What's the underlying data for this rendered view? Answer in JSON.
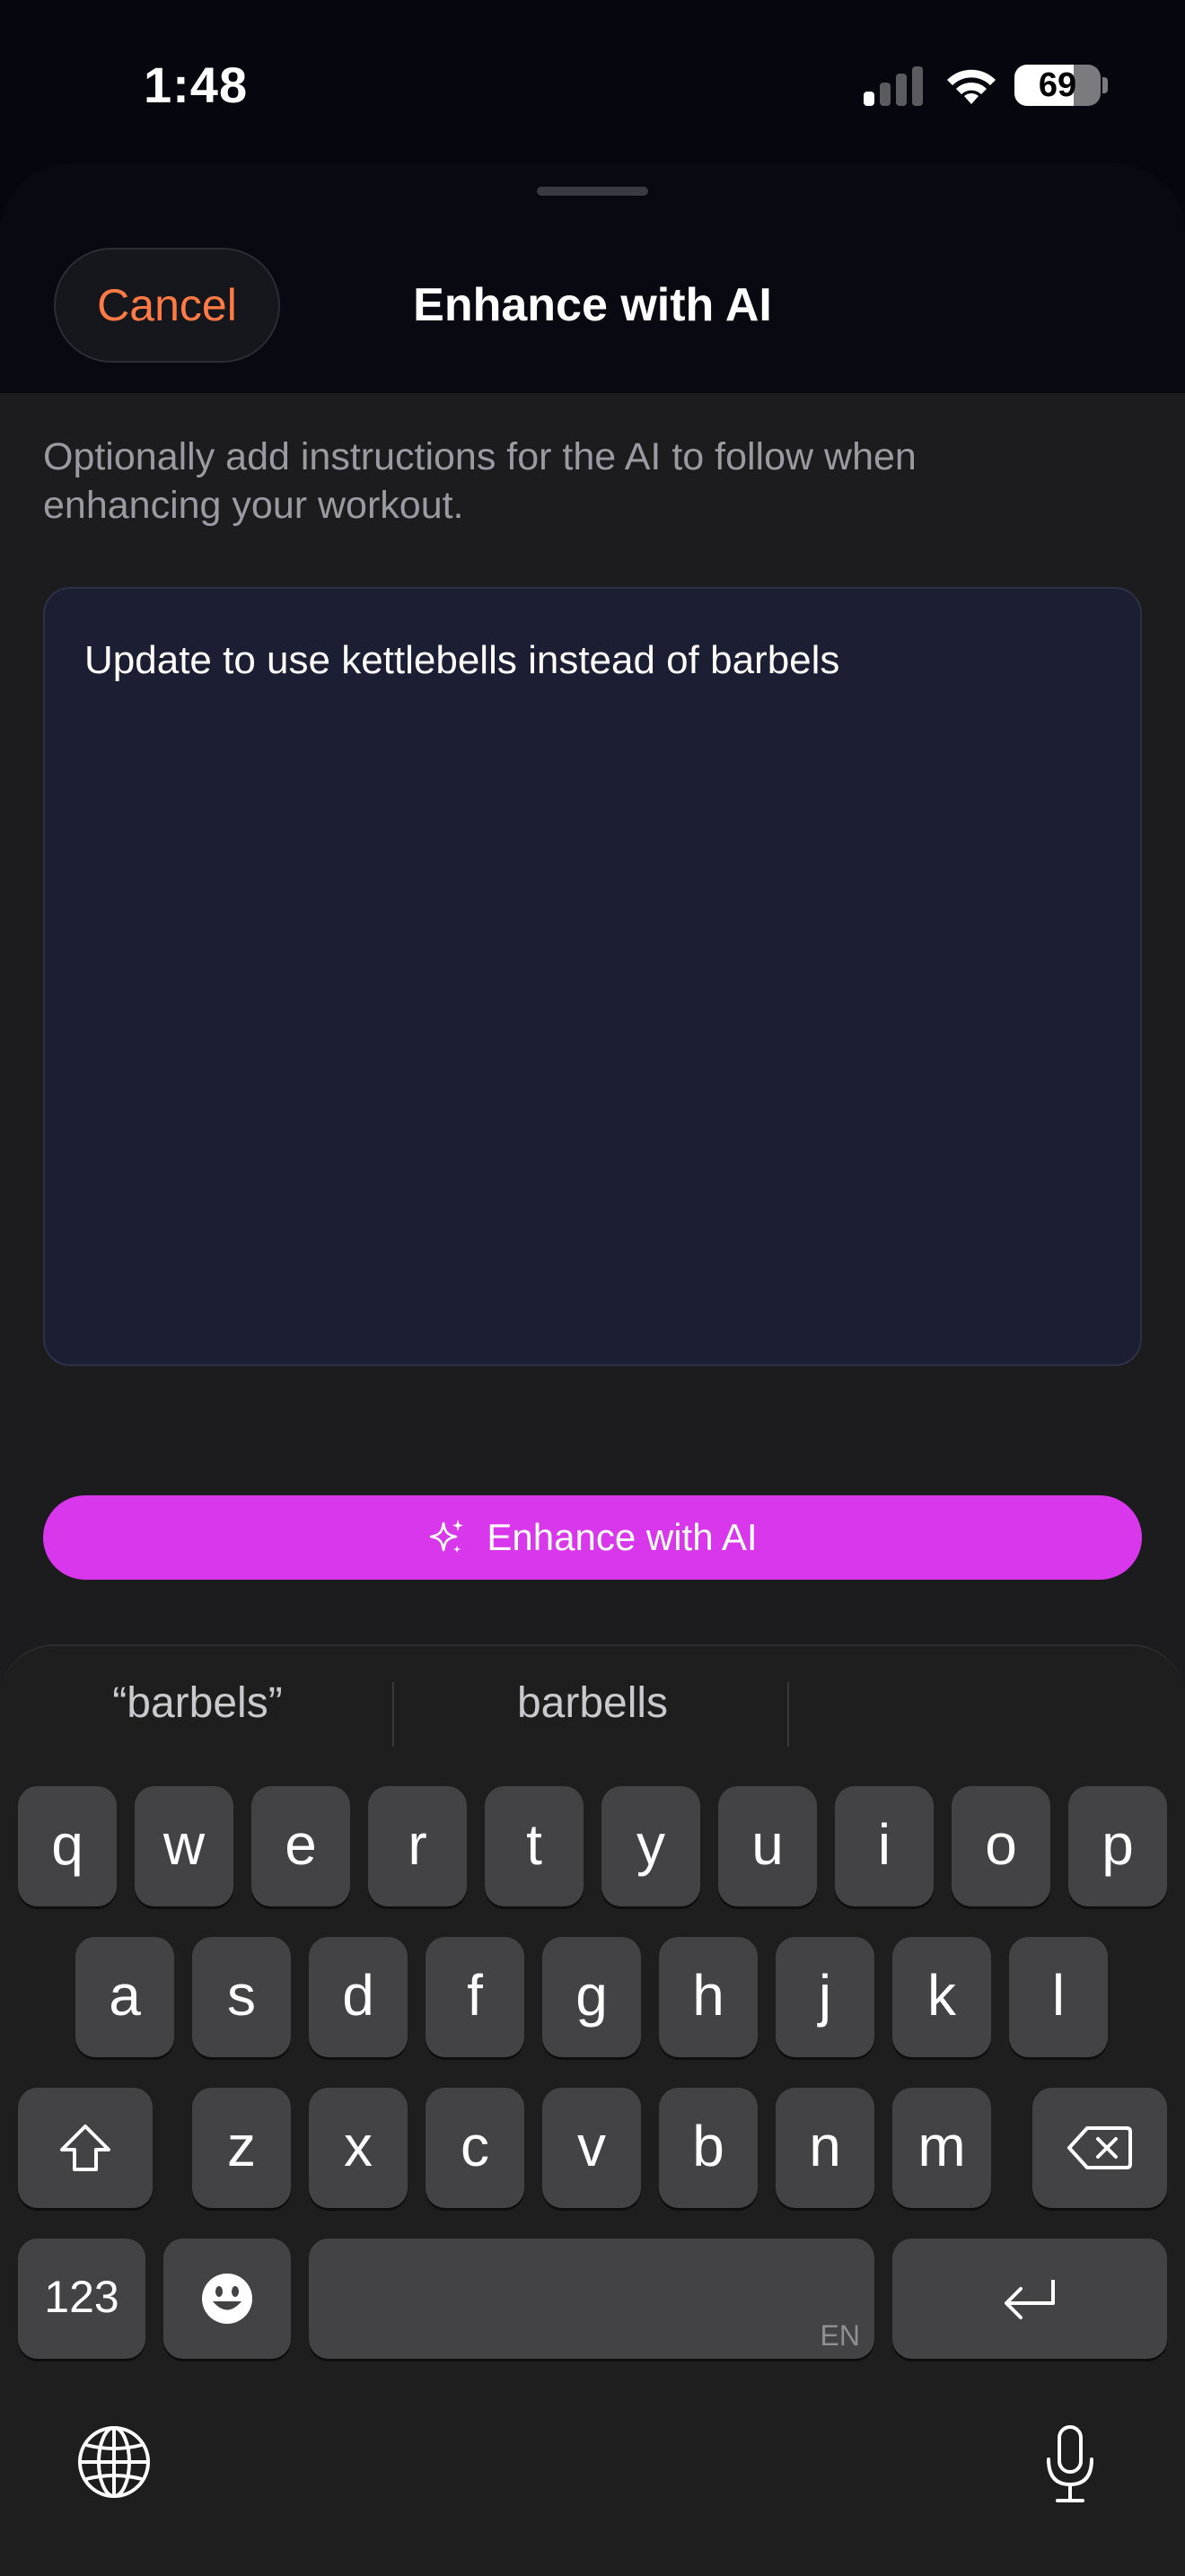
{
  "status_bar": {
    "time": "1:48",
    "battery": "69",
    "signal_bars_active": 1
  },
  "sheet": {
    "cancel_label": "Cancel",
    "title": "Enhance with AI",
    "instructions": "Optionally add instructions for the AI to follow when enhancing your workout.",
    "instructions_value": "Update to use kettlebells instead of barbels",
    "enhance_button_label": "Enhance with AI",
    "colors": {
      "accent": "#d937ec",
      "cancel": "#ff7a45",
      "field_bg": "#1c1f33"
    }
  },
  "keyboard": {
    "suggestions": [
      "“barbels”",
      "barbells",
      ""
    ],
    "row1": [
      "q",
      "w",
      "e",
      "r",
      "t",
      "y",
      "u",
      "i",
      "o",
      "p"
    ],
    "row2": [
      "a",
      "s",
      "d",
      "f",
      "g",
      "h",
      "j",
      "k",
      "l"
    ],
    "row3": [
      "z",
      "x",
      "c",
      "v",
      "b",
      "n",
      "m"
    ],
    "numbers_label": "123",
    "language_indicator": "EN",
    "icons": [
      "shift-icon",
      "delete-icon",
      "emoji-icon",
      "return-icon",
      "globe-icon",
      "microphone-icon"
    ]
  }
}
